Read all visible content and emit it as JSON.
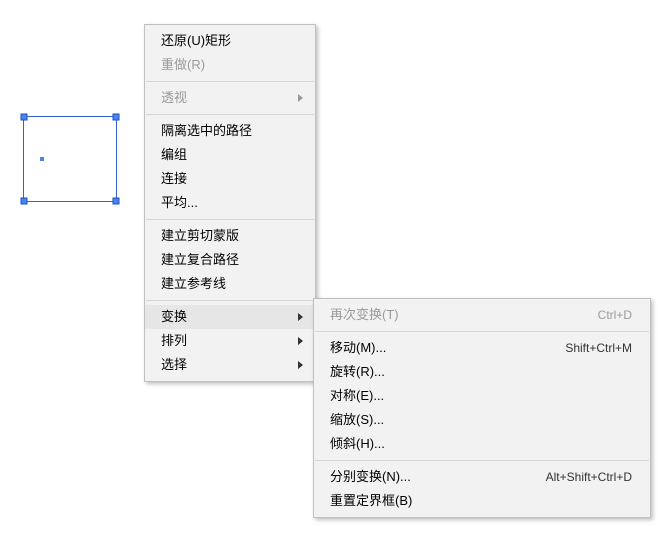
{
  "canvas": {
    "anchors": [
      "tl",
      "tr",
      "bl",
      "br"
    ]
  },
  "menu_main": {
    "undo": {
      "label": "还原(U)矩形"
    },
    "redo": {
      "label": "重做(R)"
    },
    "perspective": {
      "label": "透视"
    },
    "isolate_path": {
      "label": "隔离选中的路径"
    },
    "group": {
      "label": "编组"
    },
    "join": {
      "label": "连接"
    },
    "average": {
      "label": "平均..."
    },
    "make_clip_mask": {
      "label": "建立剪切蒙版"
    },
    "make_compound": {
      "label": "建立复合路径"
    },
    "make_guides": {
      "label": "建立参考线"
    },
    "transform": {
      "label": "变换"
    },
    "arrange": {
      "label": "排列"
    },
    "select": {
      "label": "选择"
    }
  },
  "menu_transform": {
    "transform_again": {
      "label": "再次变换(T)",
      "shortcut": "Ctrl+D"
    },
    "move": {
      "label": "移动(M)...",
      "shortcut": "Shift+Ctrl+M"
    },
    "rotate": {
      "label": "旋转(R)..."
    },
    "reflect": {
      "label": "对称(E)..."
    },
    "scale": {
      "label": "缩放(S)..."
    },
    "shear": {
      "label": "倾斜(H)..."
    },
    "transform_each": {
      "label": "分别变换(N)...",
      "shortcut": "Alt+Shift+Ctrl+D"
    },
    "reset_bbox": {
      "label": "重置定界框(B)"
    }
  }
}
